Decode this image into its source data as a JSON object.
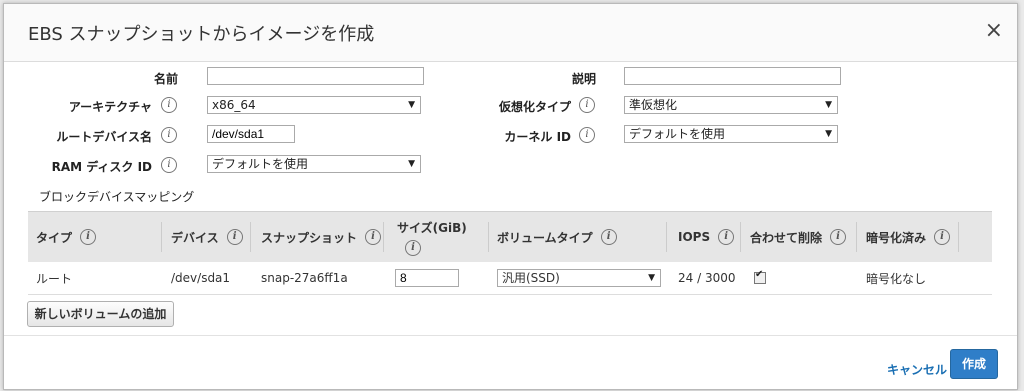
{
  "dialog": {
    "title": "EBS スナップショットからイメージを作成",
    "close": "×"
  },
  "form": {
    "name_label": "名前",
    "name_value": "",
    "desc_label": "説明",
    "desc_value": "",
    "arch_label": "アーキテクチャ",
    "arch_value": "x86_64",
    "virt_label": "仮想化タイプ",
    "virt_value": "準仮想化",
    "root_label": "ルートデバイス名",
    "root_value": "/dev/sda1",
    "kernel_label": "カーネル ID",
    "kernel_value": "デフォルトを使用",
    "ramdisk_label": "RAM ディスク ID",
    "ramdisk_value": "デフォルトを使用",
    "info_glyph": "i"
  },
  "mapping": {
    "section_title": "ブロックデバイスマッピング",
    "headers": {
      "type": "タイプ",
      "device": "デバイス",
      "snapshot": "スナップショット",
      "size": "サイズ(GiB)",
      "volume_type": "ボリュームタイプ",
      "iops": "IOPS",
      "delete": "合わせて削除",
      "encrypted": "暗号化済み"
    },
    "row": {
      "type": "ルート",
      "device": "/dev/sda1",
      "snapshot": "snap-27a6ff1a",
      "size": "8",
      "volume_type": "汎用(SSD)",
      "iops": "24 / 3000",
      "delete_checked": true,
      "encrypted": "暗号化なし"
    },
    "add_button": "新しいボリュームの追加"
  },
  "footer": {
    "cancel": "キャンセル",
    "create": "作成"
  }
}
